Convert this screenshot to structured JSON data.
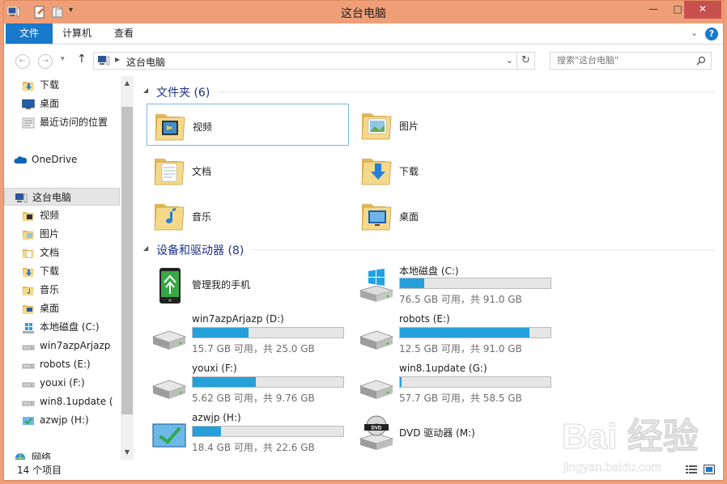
{
  "window": {
    "title": "这台电脑"
  },
  "ribbon": {
    "tabs": [
      "文件",
      "计算机",
      "查看"
    ],
    "help": "?"
  },
  "address": {
    "path": "这台电脑",
    "search_placeholder": "搜索\"这台电脑\""
  },
  "sidebar": {
    "items": [
      {
        "label": "下载",
        "icon": "download-folder-icon"
      },
      {
        "label": "桌面",
        "icon": "desktop-icon"
      },
      {
        "label": "最近访问的位置",
        "icon": "recent-places-icon"
      },
      {
        "label": "OneDrive",
        "icon": "onedrive-cloud-icon"
      },
      {
        "label": "这台电脑",
        "icon": "computer-icon"
      },
      {
        "label": "视频",
        "icon": "videos-folder-icon"
      },
      {
        "label": "图片",
        "icon": "pictures-folder-icon"
      },
      {
        "label": "文档",
        "icon": "documents-folder-icon"
      },
      {
        "label": "下载",
        "icon": "download-folder-icon"
      },
      {
        "label": "音乐",
        "icon": "music-folder-icon"
      },
      {
        "label": "桌面",
        "icon": "desktop-folder-icon"
      },
      {
        "label": "本地磁盘 (C:)",
        "icon": "windows-drive-icon"
      },
      {
        "label": "win7azpArjazp",
        "icon": "drive-icon"
      },
      {
        "label": "robots (E:)",
        "icon": "drive-icon"
      },
      {
        "label": "youxi (F:)",
        "icon": "drive-icon"
      },
      {
        "label": "win8.1update (",
        "icon": "drive-icon"
      },
      {
        "label": "azwjp (H:)",
        "icon": "recycle-drive-icon"
      },
      {
        "label": "网络",
        "icon": "network-icon"
      }
    ]
  },
  "folders": {
    "header": "文件夹 (6)",
    "items": [
      {
        "label": "视频",
        "icon": "videos-folder-icon"
      },
      {
        "label": "图片",
        "icon": "pictures-folder-icon"
      },
      {
        "label": "文档",
        "icon": "documents-folder-icon"
      },
      {
        "label": "下载",
        "icon": "download-folder-icon"
      },
      {
        "label": "音乐",
        "icon": "music-folder-icon"
      },
      {
        "label": "桌面",
        "icon": "desktop-folder-icon"
      }
    ]
  },
  "devices": {
    "header": "设备和驱动器 (8)",
    "phone": {
      "label": "管理我的手机",
      "icon": "phone-manager-icon"
    },
    "dvd": {
      "label": "DVD 驱动器 (M:)",
      "icon": "dvd-drive-icon"
    },
    "drives": [
      {
        "label": "本地磁盘 (C:)",
        "info": "76.5 GB 可用，共 91.0 GB",
        "used": 0.16,
        "icon": "windows-drive-icon"
      },
      {
        "label": "win7azpArjazp (D:)",
        "info": "15.7 GB 可用，共 25.0 GB",
        "used": 0.37,
        "icon": "drive-icon"
      },
      {
        "label": "robots (E:)",
        "info": "12.5 GB 可用，共 91.0 GB",
        "used": 0.86,
        "icon": "drive-icon"
      },
      {
        "label": "youxi (F:)",
        "info": "5.62 GB 可用，共 9.76 GB",
        "used": 0.42,
        "icon": "drive-icon"
      },
      {
        "label": "win8.1update (G:)",
        "info": "57.7 GB 可用，共 58.5 GB",
        "used": 0.01,
        "icon": "drive-icon"
      },
      {
        "label": "azwjp (H:)",
        "info": "18.4 GB 可用，共 22.6 GB",
        "used": 0.19,
        "icon": "recycle-drive-icon"
      }
    ]
  },
  "status": {
    "count": "14 个项目"
  },
  "watermark": {
    "brand": "Bai 经验",
    "url": "jingyan.baidu.com"
  },
  "colors": {
    "accent": "#1979ca",
    "title_bar": "#ee9f78",
    "drive_bar": "#26a0da",
    "group_header": "#1e3287"
  }
}
